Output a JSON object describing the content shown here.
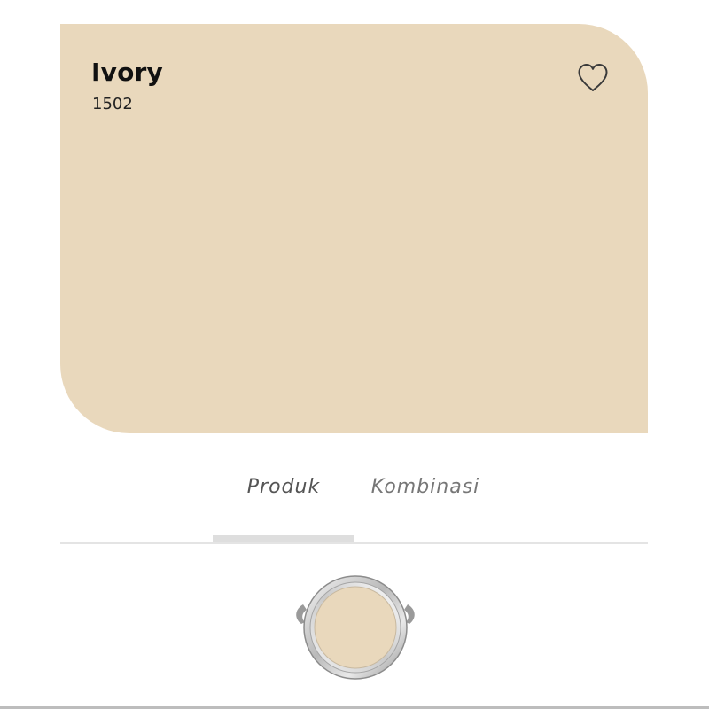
{
  "swatch": {
    "name": "Ivory",
    "code": "1502",
    "color": "#e9d8bc",
    "favorite_icon": "heart-outline-icon"
  },
  "tabs": {
    "items": [
      {
        "label": "Produk",
        "active": true
      },
      {
        "label": "Kombinasi",
        "active": false
      }
    ]
  },
  "product": {
    "icon": "paint-can-icon",
    "color": "#e9d8bc"
  }
}
